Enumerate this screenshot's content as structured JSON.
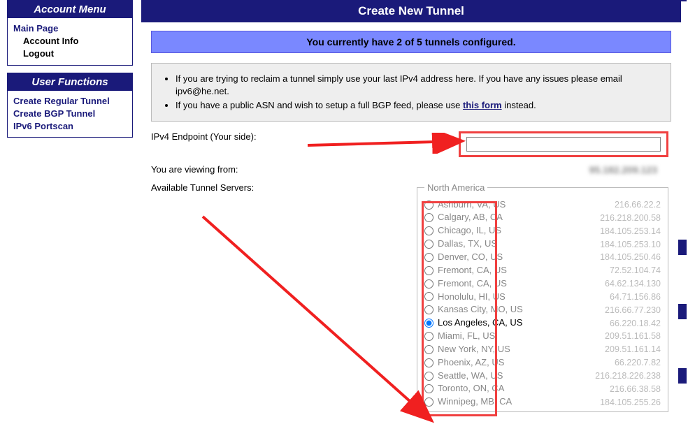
{
  "sidebar": {
    "account_menu": {
      "title": "Account Menu",
      "main_page": "Main Page",
      "account_info": "Account Info",
      "logout": "Logout"
    },
    "user_functions": {
      "title": "User Functions",
      "create_regular": "Create Regular Tunnel",
      "create_bgp": "Create BGP Tunnel",
      "portscan": "IPv6 Portscan"
    }
  },
  "main": {
    "title": "Create New Tunnel",
    "banner": "You currently have 2 of 5 tunnels configured.",
    "info1": "If you are trying to reclaim a tunnel simply use your last IPv4 address here. If you have any issues please email ipv6@he.net.",
    "info2_pre": "If you have a public ASN and wish to setup a full BGP feed, please use ",
    "info2_link": "this form",
    "info2_post": " instead.",
    "label_endpoint": "IPv4 Endpoint (Your side):",
    "label_viewing": "You are viewing from:",
    "label_servers": "Available Tunnel Servers:",
    "viewing_ip": "95.182.209.123",
    "region0_label": "North America",
    "servers": [
      {
        "loc": "Ashburn, VA, US",
        "ip": "216.66.22.2",
        "sel": false
      },
      {
        "loc": "Calgary, AB, CA",
        "ip": "216.218.200.58",
        "sel": false
      },
      {
        "loc": "Chicago, IL, US",
        "ip": "184.105.253.14",
        "sel": false
      },
      {
        "loc": "Dallas, TX, US",
        "ip": "184.105.253.10",
        "sel": false
      },
      {
        "loc": "Denver, CO, US",
        "ip": "184.105.250.46",
        "sel": false
      },
      {
        "loc": "Fremont, CA, US",
        "ip": "72.52.104.74",
        "sel": false
      },
      {
        "loc": "Fremont, CA, US",
        "ip": "64.62.134.130",
        "sel": false
      },
      {
        "loc": "Honolulu, HI, US",
        "ip": "64.71.156.86",
        "sel": false
      },
      {
        "loc": "Kansas City, MO, US",
        "ip": "216.66.77.230",
        "sel": false
      },
      {
        "loc": "Los Angeles, CA, US",
        "ip": "66.220.18.42",
        "sel": true
      },
      {
        "loc": "Miami, FL, US",
        "ip": "209.51.161.58",
        "sel": false
      },
      {
        "loc": "New York, NY, US",
        "ip": "209.51.161.14",
        "sel": false
      },
      {
        "loc": "Phoenix, AZ, US",
        "ip": "66.220.7.82",
        "sel": false
      },
      {
        "loc": "Seattle, WA, US",
        "ip": "216.218.226.238",
        "sel": false
      },
      {
        "loc": "Toronto, ON, CA",
        "ip": "216.66.38.58",
        "sel": false
      },
      {
        "loc": "Winnipeg, MB, CA",
        "ip": "184.105.255.26",
        "sel": false
      }
    ]
  }
}
